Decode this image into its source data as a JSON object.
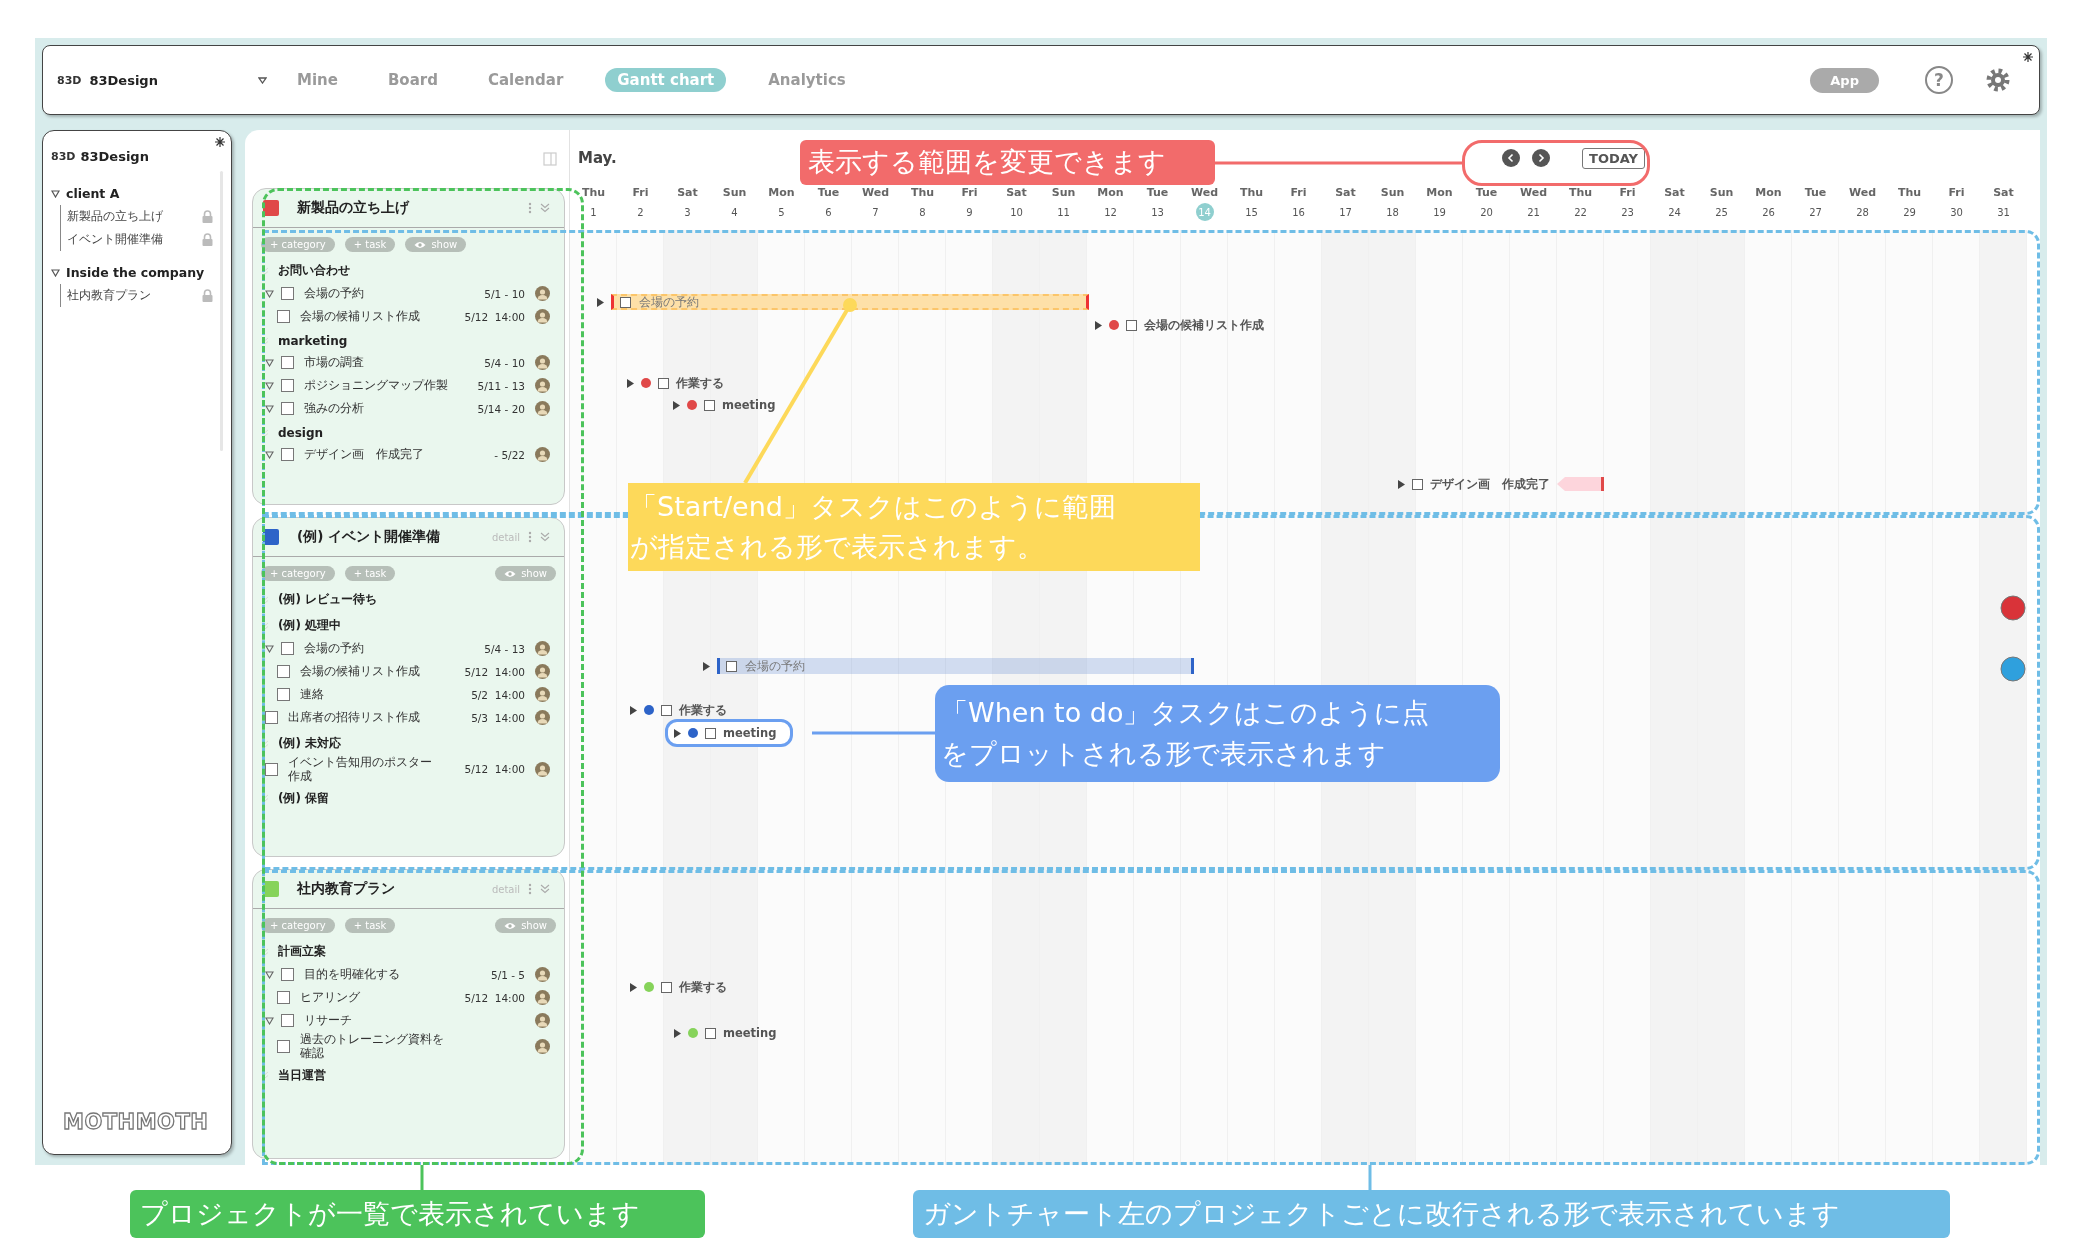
{
  "top_bar": {
    "logo": "83D",
    "name": "83Design",
    "tabs": [
      {
        "label": "Mine",
        "selected": false
      },
      {
        "label": "Board",
        "selected": false
      },
      {
        "label": "Calendar",
        "selected": false
      },
      {
        "label": "Gantt chart",
        "selected": true
      },
      {
        "label": "Analytics",
        "selected": false
      }
    ],
    "app_button": "App",
    "help": "?"
  },
  "sidebar": {
    "logo": "83D",
    "name": "83Design",
    "groups": [
      {
        "name": "client A",
        "expanded": true,
        "items": [
          {
            "label": "新製品の立ち上げ",
            "locked": true
          },
          {
            "label": "イベント開催準備",
            "locked": true
          }
        ]
      },
      {
        "name": "Inside the company",
        "expanded": true,
        "items": [
          {
            "label": "社内教育プラン",
            "locked": true
          }
        ]
      }
    ],
    "footer_logo": "MOTHMOTH"
  },
  "gantt": {
    "month": "May.",
    "today_button": "TODAY",
    "days": [
      {
        "weekday": "Thu",
        "date": "1",
        "today": false
      },
      {
        "weekday": "Fri",
        "date": "2",
        "today": false
      },
      {
        "weekday": "Sat",
        "date": "3",
        "today": false
      },
      {
        "weekday": "Sun",
        "date": "4",
        "today": false
      },
      {
        "weekday": "Mon",
        "date": "5",
        "today": false
      },
      {
        "weekday": "Tue",
        "date": "6",
        "today": false
      },
      {
        "weekday": "Wed",
        "date": "7",
        "today": false
      },
      {
        "weekday": "Thu",
        "date": "8",
        "today": false
      },
      {
        "weekday": "Fri",
        "date": "9",
        "today": false
      },
      {
        "weekday": "Sat",
        "date": "10",
        "today": false
      },
      {
        "weekday": "Sun",
        "date": "11",
        "today": false
      },
      {
        "weekday": "Mon",
        "date": "12",
        "today": false
      },
      {
        "weekday": "Tue",
        "date": "13",
        "today": false
      },
      {
        "weekday": "Wed",
        "date": "14",
        "today": true
      },
      {
        "weekday": "Thu",
        "date": "15",
        "today": false
      },
      {
        "weekday": "Fri",
        "date": "16",
        "today": false
      },
      {
        "weekday": "Sat",
        "date": "17",
        "today": false
      },
      {
        "weekday": "Sun",
        "date": "18",
        "today": false
      },
      {
        "weekday": "Mon",
        "date": "19",
        "today": false
      },
      {
        "weekday": "Tue",
        "date": "20",
        "today": false
      },
      {
        "weekday": "Wed",
        "date": "21",
        "today": false
      },
      {
        "weekday": "Thu",
        "date": "22",
        "today": false
      },
      {
        "weekday": "Fri",
        "date": "23",
        "today": false
      },
      {
        "weekday": "Sat",
        "date": "24",
        "today": false
      },
      {
        "weekday": "Sun",
        "date": "25",
        "today": false
      },
      {
        "weekday": "Mon",
        "date": "26",
        "today": false
      },
      {
        "weekday": "Tue",
        "date": "27",
        "today": false
      },
      {
        "weekday": "Wed",
        "date": "28",
        "today": false
      },
      {
        "weekday": "Thu",
        "date": "29",
        "today": false
      },
      {
        "weekday": "Fri",
        "date": "30",
        "today": false
      },
      {
        "weekday": "Sat",
        "date": "31",
        "today": false
      }
    ]
  },
  "projects": [
    {
      "title": "新製品の立ち上げ",
      "color": "#e04848",
      "actions": [
        "+ category",
        "+ task"
      ],
      "show": "show",
      "categories": [
        {
          "name": "お問い合わせ",
          "tasks": [
            {
              "label": "会場の予約",
              "date": "5/1 - 10",
              "checked": false,
              "expanded": true,
              "children": [
                {
                  "label": "会場の候補リスト作成",
                  "date": "5/12  14:00",
                  "checked": false,
                  "expanded": false
                }
              ]
            }
          ]
        },
        {
          "name": "marketing",
          "tasks": [
            {
              "label": "市場の調査",
              "date": "5/4 - 10",
              "checked": false,
              "expanded": true
            },
            {
              "label": "ポジショニングマップ作製",
              "date": "5/11 - 13",
              "checked": false,
              "expanded": true
            },
            {
              "label": "強みの分析",
              "date": "5/14 - 20",
              "checked": false,
              "expanded": true
            }
          ]
        },
        {
          "name": "design",
          "tasks": [
            {
              "label": "デザイン画　作成完了",
              "date": "- 5/22",
              "checked": false,
              "expanded": true
            }
          ]
        }
      ],
      "gantt_items": [
        {
          "kind": "range",
          "label": "会場の予約",
          "checked": false,
          "highlighted": true
        },
        {
          "kind": "point",
          "label": "会場の候補リスト作成",
          "checked": false,
          "highlighted": false
        },
        {
          "kind": "point",
          "label": "作業する",
          "checked": false,
          "highlighted": false
        },
        {
          "kind": "point",
          "label": "meeting",
          "checked": false,
          "highlighted": false
        },
        {
          "kind": "deadline",
          "label": "デザイン画　作成完了",
          "checked": false,
          "highlighted": false
        }
      ]
    },
    {
      "title": "(例) イベント開催準備",
      "color": "#2d63c8",
      "detail": "detail",
      "actions": [
        "+ category",
        "+ task"
      ],
      "show": "show",
      "categories": [
        {
          "name": "(例) レビュー待ち"
        },
        {
          "name": "(例) 処理中",
          "tasks": [
            {
              "label": "会場の予約",
              "date": "5/4 - 13",
              "checked": false,
              "expanded": true,
              "children": [
                {
                  "label": "会場の候補リスト作成",
                  "date": "5/12  14:00",
                  "checked": false,
                  "expanded": false
                },
                {
                  "label": "連絡",
                  "date": "5/2  14:00",
                  "checked": false,
                  "expanded": false
                }
              ]
            },
            {
              "label": "出席者の招待リスト作成",
              "date": "5/3  14:00",
              "checked": false,
              "expanded": false
            }
          ]
        },
        {
          "name": "(例) 未対応",
          "tasks": [
            {
              "label": "イベント告知用のポスター作成",
              "date": "5/12  14:00",
              "checked": false,
              "expanded": false
            }
          ]
        },
        {
          "name": "(例) 保留"
        }
      ],
      "gantt_items": [
        {
          "kind": "range",
          "label": "会場の予約",
          "checked": false,
          "highlighted": false
        },
        {
          "kind": "point",
          "label": "作業する",
          "checked": false,
          "highlighted": false
        },
        {
          "kind": "point",
          "label": "meeting",
          "checked": false,
          "highlighted": true
        }
      ]
    },
    {
      "title": "社内教育プラン",
      "color": "#86d35a",
      "detail": "detail",
      "actions": [
        "+ category",
        "+ task"
      ],
      "show": "show",
      "categories": [
        {
          "name": "計画立案",
          "tasks": [
            {
              "label": "目的を明確化する",
              "date": "5/1 - 5",
              "checked": false,
              "expanded": true,
              "children": [
                {
                  "label": "ヒアリング",
                  "date": "5/12  14:00",
                  "checked": false,
                  "expanded": false
                }
              ]
            },
            {
              "label": "リサーチ",
              "checked": false,
              "expanded": true,
              "children": [
                {
                  "label": "過去のトレーニング資料を確認",
                  "checked": false,
                  "expanded": false
                }
              ]
            }
          ]
        },
        {
          "name": "当日運営"
        }
      ],
      "gantt_items": [
        {
          "kind": "point",
          "label": "作業する",
          "checked": false,
          "highlighted": false
        },
        {
          "kind": "point",
          "label": "meeting",
          "checked": false,
          "highlighted": false
        }
      ]
    }
  ],
  "annotations": [
    {
      "text": "表示する範囲を変更できます",
      "color": "#f26b6b"
    },
    {
      "text": "「Start/end」タスクはこのように範囲が指定される形で表示されます。",
      "color": "#fdd95a"
    },
    {
      "text": "「When to do」タスクはこのように点をプロットされる形で表示されます",
      "color": "#6b9ff0"
    },
    {
      "text": "プロジェクトが一覧で表示されています",
      "color": "#4cc35b"
    },
    {
      "text": "ガントチャート左のプロジェクトごとに改行される形で表示されています",
      "color": "#6fbde6"
    }
  ]
}
